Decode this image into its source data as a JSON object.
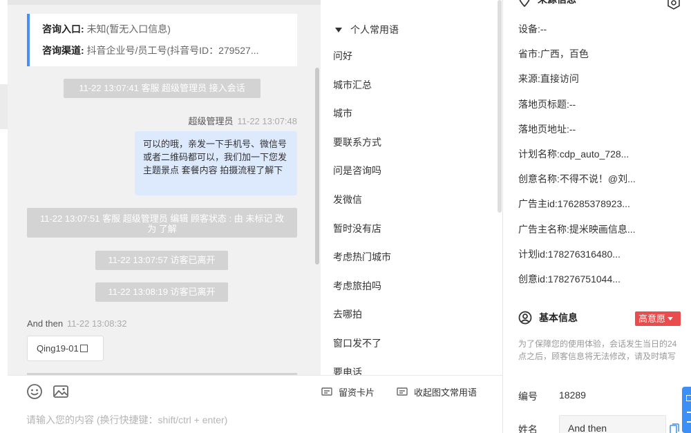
{
  "inquiry": {
    "entry_label": "咨询入口:",
    "entry_value": "未知(暂无入口信息)",
    "channel_label": "咨询渠道:",
    "channel_value": "抖音企业号/员工号(抖音号ID：279527..."
  },
  "messages": {
    "sys1": "11-22 13:07:41 客服 超级管理员 接入会话",
    "agent_name": "超级管理员",
    "agent_time": "11-22 13:07:48",
    "agent_text": "可以的哦，亲发一下手机号、微信号或者二维码都可以，我们加一下您发主题景点 套餐内容 拍摄流程了解下",
    "sys2": "11-22 13:07:51 客服 超级管理员 编辑 顾客状态 : 由 未标记 改为 了解",
    "sys3": "11-22 13:07:57 访客已离开",
    "sys4": "11-22 13:08:19 访客已离开",
    "visitor_name": "And then",
    "visitor_time": "11-22 13:08:32",
    "visitor_text": "Qing19-01"
  },
  "composer": {
    "emoji_icon": "emoji-icon",
    "image_icon": "image-icon",
    "card_label": "留资卡片",
    "collapse_label": "收起图文常用语",
    "placeholder": "请输入您的内容 (换行快捷键：shift/ctrl + enter)"
  },
  "phrases": {
    "header": "个人常用语",
    "items": [
      "问好",
      "城市汇总",
      "城市",
      "要联系方式",
      "问是咨询吗",
      "发微信",
      "暂时没有店",
      "考虑热门城市",
      "考虑旅拍吗",
      "去哪拍",
      "窗口发不了",
      "要电话"
    ]
  },
  "source": {
    "title": "来源信息",
    "rows": [
      {
        "k": "设备:",
        "v": "--"
      },
      {
        "k": "省市:",
        "v": "广西，百色"
      },
      {
        "k": "来源:",
        "v": "直接访问"
      },
      {
        "k": "落地页标题:",
        "v": "--"
      },
      {
        "k": "落地页地址:",
        "v": "--"
      },
      {
        "k": "计划名称:",
        "v": "cdp_auto_728..."
      },
      {
        "k": "创意名称:",
        "v": "不得不说！@刘..."
      },
      {
        "k": "广告主id:",
        "v": "176285378923..."
      },
      {
        "k": "广告主名称:",
        "v": "提米映画信息..."
      },
      {
        "k": "计划id:",
        "v": "178276316480..."
      },
      {
        "k": "创意id:",
        "v": "178276751044..."
      }
    ]
  },
  "basic": {
    "title": "基本信息",
    "intent": "高意愿",
    "note": "为了保障您的使用体验，会话发生当日的24点之后，顾客信息将无法修改，请及时填写",
    "number_label": "编号",
    "number_value": "18289",
    "name_label": "姓名",
    "name_value": "And then"
  },
  "colors": {
    "accent": "#4a8ff7",
    "intent_red": "#e84c4c",
    "agent_bubble": "#dde9fd",
    "sys_msg": "#d3d3d3"
  }
}
